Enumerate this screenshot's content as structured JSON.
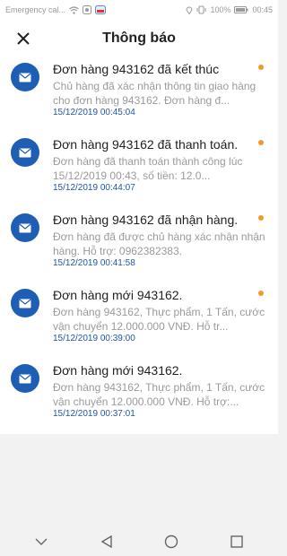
{
  "status_bar": {
    "carrier": "Emergency cal...",
    "battery": "100%",
    "time": "00:45"
  },
  "header": {
    "title": "Thông báo",
    "close_icon": "close-icon"
  },
  "notifications": [
    {
      "title": "Đơn hàng 943162 đã kết thúc",
      "body": "Chủ hàng đã xác nhận thông tin giao hàng cho đơn hàng 943162. Đơn hàng đ...",
      "time": "15/12/2019 00:45:04",
      "unread": true
    },
    {
      "title": "Đơn hàng 943162 đã thanh toán.",
      "body": "Đơn hàng đã thanh toán thành công lúc 15/12/2019 00:43, số tiền: 12.0...",
      "time": "15/12/2019 00:44:07",
      "unread": true
    },
    {
      "title": "Đơn hàng 943162 đã nhận hàng.",
      "body": "Đơn hàng đã được chủ hàng xác nhận nhận hàng. Hỗ trợ: 0962382383.",
      "time": "15/12/2019 00:41:58",
      "unread": true
    },
    {
      "title": "Đơn hàng mới 943162.",
      "body": "Đơn hàng 943162, Thực phẩm, 1 Tấn, cước vận chuyển 12.000.000 VNĐ. Hỗ tr...",
      "time": "15/12/2019 00:39:00",
      "unread": true
    },
    {
      "title": "Đơn hàng mới 943162.",
      "body": "Đơn hàng 943162, Thực phẩm, 1 Tấn, cước vận chuyển 12.000.000 VNĐ. Hỗ trợ:...",
      "time": "15/12/2019 00:37:01",
      "unread": false
    }
  ],
  "colors": {
    "accent": "#1e5fb4",
    "unread_dot": "#f39a2b",
    "timestamp": "#1f57a8"
  },
  "nav": {
    "icons": [
      "chevron-down-icon",
      "back-triangle-icon",
      "home-circle-icon",
      "recents-square-icon"
    ]
  }
}
